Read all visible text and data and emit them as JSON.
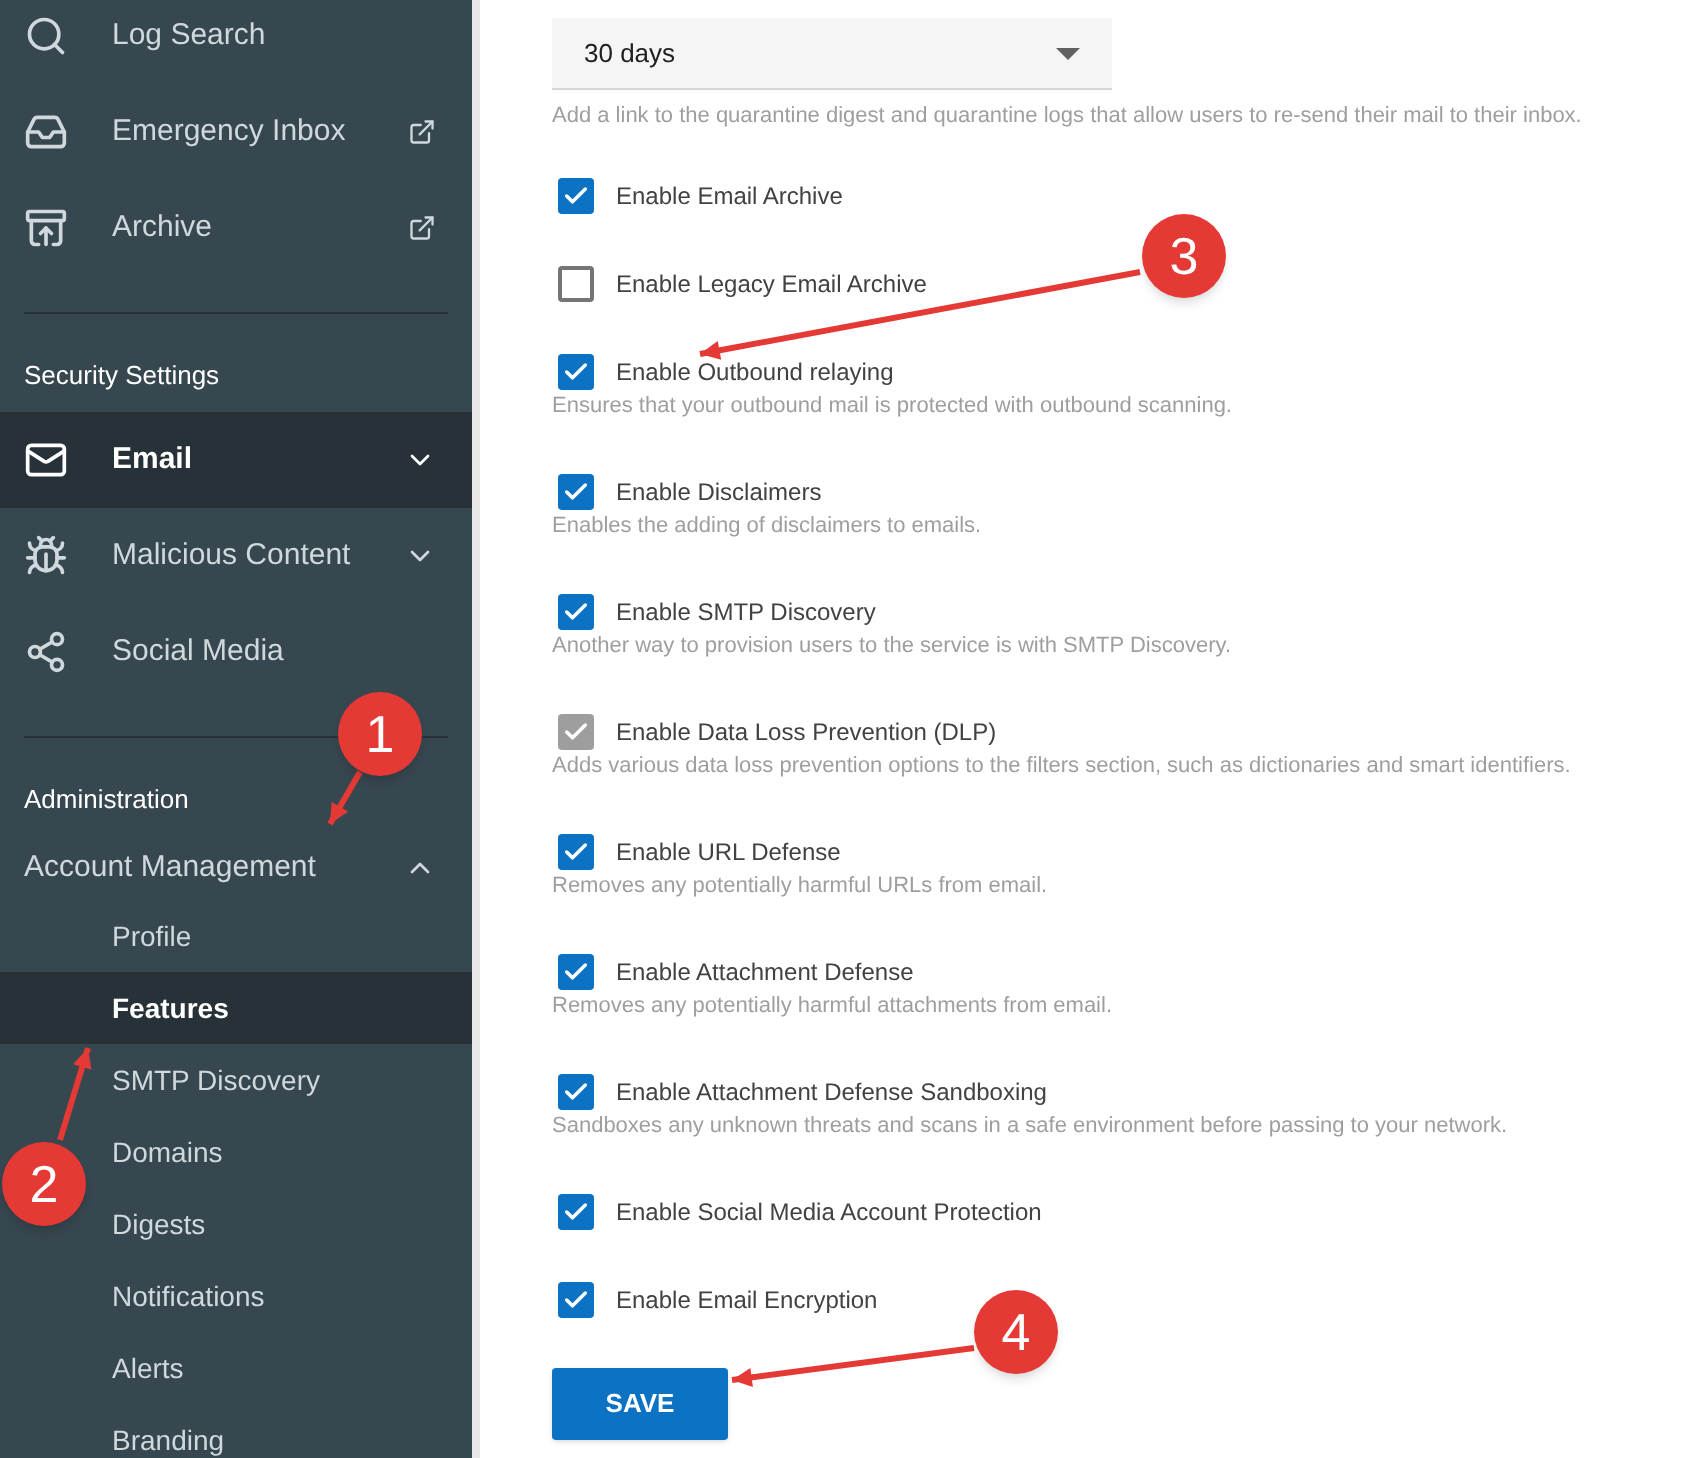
{
  "sidebar": {
    "top_items": [
      {
        "label": "Log Search"
      },
      {
        "label": "Emergency Inbox"
      },
      {
        "label": "Archive"
      }
    ],
    "sections": [
      {
        "title": "Security Settings",
        "items": [
          {
            "label": "Email",
            "selected": true,
            "expanded": false
          },
          {
            "label": "Malicious Content",
            "selected": false,
            "expanded": false
          },
          {
            "label": "Social Media",
            "selected": false
          }
        ]
      },
      {
        "title": "Administration",
        "items": [
          {
            "label": "Account Management",
            "selected": false,
            "expanded": true,
            "children": [
              {
                "label": "Profile",
                "selected": false
              },
              {
                "label": "Features",
                "selected": true
              },
              {
                "label": "SMTP Discovery",
                "selected": false
              },
              {
                "label": "Domains",
                "selected": false
              },
              {
                "label": "Digests",
                "selected": false
              },
              {
                "label": "Notifications",
                "selected": false
              },
              {
                "label": "Alerts",
                "selected": false
              },
              {
                "label": "Branding",
                "selected": false
              }
            ]
          }
        ]
      }
    ]
  },
  "instant_replay": {
    "value": "30 days",
    "help": "Add a link to the quarantine digest and quarantine logs that allow users to re-send their mail to their inbox."
  },
  "options": [
    {
      "label": "Enable Email Archive",
      "checked": true,
      "disabled": false
    },
    {
      "label": "Enable Legacy Email Archive",
      "checked": false,
      "disabled": false
    },
    {
      "label": "Enable Outbound relaying",
      "checked": true,
      "disabled": false,
      "description": "Ensures that your outbound mail is protected with outbound scanning."
    },
    {
      "label": "Enable Disclaimers",
      "checked": true,
      "disabled": false,
      "description": "Enables the adding of disclaimers to emails."
    },
    {
      "label": "Enable SMTP Discovery",
      "checked": true,
      "disabled": false,
      "description": "Another way to provision users to the service is with SMTP Discovery."
    },
    {
      "label": "Enable Data Loss Prevention (DLP)",
      "checked": true,
      "disabled": true,
      "description": "Adds various data loss prevention options to the filters section, such as dictionaries and smart identifiers."
    },
    {
      "label": "Enable URL Defense",
      "checked": true,
      "disabled": false,
      "description": "Removes any potentially harmful URLs from email."
    },
    {
      "label": "Enable Attachment Defense",
      "checked": true,
      "disabled": false,
      "description": "Removes any potentially harmful attachments from email."
    },
    {
      "label": "Enable Attachment Defense Sandboxing",
      "checked": true,
      "disabled": false,
      "description": "Sandboxes any unknown threats and scans in a safe environment before passing to your network."
    },
    {
      "label": "Enable Social Media Account Protection",
      "checked": true,
      "disabled": false
    },
    {
      "label": "Enable Email Encryption",
      "checked": true,
      "disabled": false
    }
  ],
  "save_button": "SAVE",
  "annotations": [
    {
      "number": "1"
    },
    {
      "number": "2"
    },
    {
      "number": "3"
    },
    {
      "number": "4"
    }
  ]
}
